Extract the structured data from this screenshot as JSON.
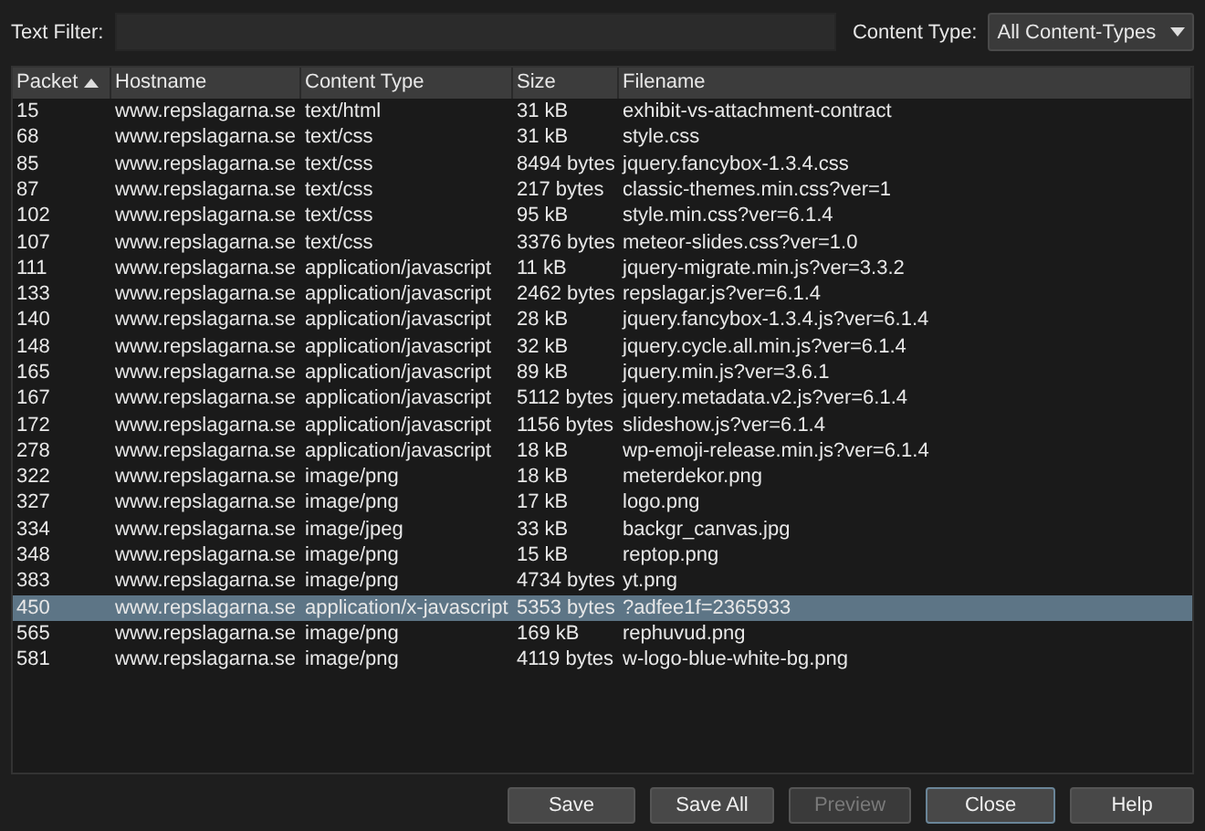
{
  "filter": {
    "label": "Text Filter:"
  },
  "content_type": {
    "label": "Content Type:",
    "value": "All Content-Types"
  },
  "table": {
    "columns": [
      {
        "label": "Packet",
        "sorted": true
      },
      {
        "label": "Hostname",
        "sorted": false
      },
      {
        "label": "Content Type",
        "sorted": false
      },
      {
        "label": "Size",
        "sorted": false
      },
      {
        "label": "Filename",
        "sorted": false
      }
    ],
    "rows": [
      {
        "cells": [
          "15",
          "www.repslagarna.se",
          "text/html",
          "31 kB",
          "exhibit-vs-attachment-contract"
        ],
        "selected": false
      },
      {
        "cells": [
          "68",
          "www.repslagarna.se",
          "text/css",
          "31 kB",
          "style.css"
        ],
        "selected": false
      },
      {
        "cells": [
          "85",
          "www.repslagarna.se",
          "text/css",
          "8494 bytes",
          "jquery.fancybox-1.3.4.css"
        ],
        "selected": false
      },
      {
        "cells": [
          "87",
          "www.repslagarna.se",
          "text/css",
          "217 bytes",
          "classic-themes.min.css?ver=1"
        ],
        "selected": false
      },
      {
        "cells": [
          "102",
          "www.repslagarna.se",
          "text/css",
          "95 kB",
          "style.min.css?ver=6.1.4"
        ],
        "selected": false
      },
      {
        "cells": [
          "107",
          "www.repslagarna.se",
          "text/css",
          "3376 bytes",
          "meteor-slides.css?ver=1.0"
        ],
        "selected": false
      },
      {
        "cells": [
          "111",
          "www.repslagarna.se",
          "application/javascript",
          "11 kB",
          "jquery-migrate.min.js?ver=3.3.2"
        ],
        "selected": false
      },
      {
        "cells": [
          "133",
          "www.repslagarna.se",
          "application/javascript",
          "2462 bytes",
          "repslagar.js?ver=6.1.4"
        ],
        "selected": false
      },
      {
        "cells": [
          "140",
          "www.repslagarna.se",
          "application/javascript",
          "28 kB",
          "jquery.fancybox-1.3.4.js?ver=6.1.4"
        ],
        "selected": false
      },
      {
        "cells": [
          "148",
          "www.repslagarna.se",
          "application/javascript",
          "32 kB",
          "jquery.cycle.all.min.js?ver=6.1.4"
        ],
        "selected": false
      },
      {
        "cells": [
          "165",
          "www.repslagarna.se",
          "application/javascript",
          "89 kB",
          "jquery.min.js?ver=3.6.1"
        ],
        "selected": false
      },
      {
        "cells": [
          "167",
          "www.repslagarna.se",
          "application/javascript",
          "5112 bytes",
          "jquery.metadata.v2.js?ver=6.1.4"
        ],
        "selected": false
      },
      {
        "cells": [
          "172",
          "www.repslagarna.se",
          "application/javascript",
          "1156 bytes",
          "slideshow.js?ver=6.1.4"
        ],
        "selected": false
      },
      {
        "cells": [
          "278",
          "www.repslagarna.se",
          "application/javascript",
          "18 kB",
          "wp-emoji-release.min.js?ver=6.1.4"
        ],
        "selected": false
      },
      {
        "cells": [
          "322",
          "www.repslagarna.se",
          "image/png",
          "18 kB",
          "meterdekor.png"
        ],
        "selected": false
      },
      {
        "cells": [
          "327",
          "www.repslagarna.se",
          "image/png",
          "17 kB",
          "logo.png"
        ],
        "selected": false
      },
      {
        "cells": [
          "334",
          "www.repslagarna.se",
          "image/jpeg",
          "33 kB",
          "backgr_canvas.jpg"
        ],
        "selected": false
      },
      {
        "cells": [
          "348",
          "www.repslagarna.se",
          "image/png",
          "15 kB",
          "reptop.png"
        ],
        "selected": false
      },
      {
        "cells": [
          "383",
          "www.repslagarna.se",
          "image/png",
          "4734 bytes",
          "yt.png"
        ],
        "selected": false
      },
      {
        "cells": [
          "450",
          "www.repslagarna.se",
          "application/x-javascript",
          "5353 bytes",
          "?adfee1f=2365933"
        ],
        "selected": true
      },
      {
        "cells": [
          "565",
          "www.repslagarna.se",
          "image/png",
          "169 kB",
          "rephuvud.png"
        ],
        "selected": false
      },
      {
        "cells": [
          "581",
          "www.repslagarna.se",
          "image/png",
          "4119 bytes",
          "w-logo-blue-white-bg.png"
        ],
        "selected": false
      }
    ]
  },
  "buttons": [
    {
      "label": "Save",
      "disabled": false,
      "focused": false
    },
    {
      "label": "Save All",
      "disabled": false,
      "focused": false
    },
    {
      "label": "Preview",
      "disabled": true,
      "focused": false
    },
    {
      "label": "Close",
      "disabled": false,
      "focused": true
    },
    {
      "label": "Help",
      "disabled": false,
      "focused": false
    }
  ]
}
